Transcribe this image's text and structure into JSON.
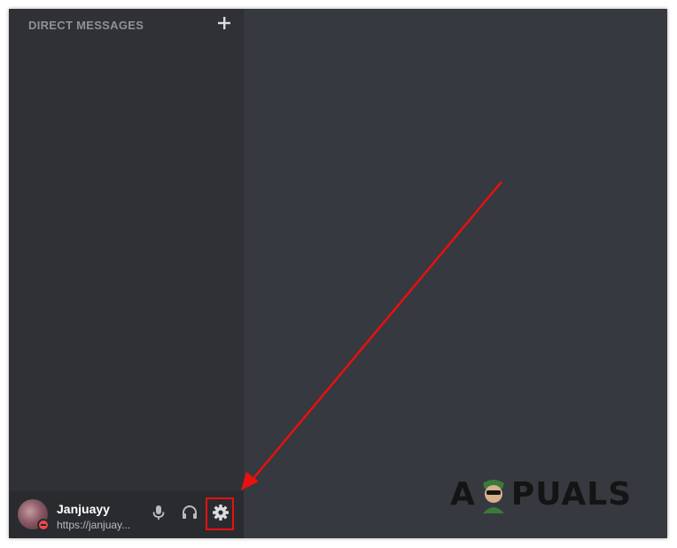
{
  "sidebar": {
    "header": "DIRECT MESSAGES",
    "add_icon": "plus-icon"
  },
  "user": {
    "name": "Janjuayy",
    "subtext": "https://janjuay...",
    "status": "do-not-disturb",
    "status_color": "#f04747"
  },
  "controls": {
    "mute_icon": "microphone-icon",
    "deafen_icon": "headphones-icon",
    "settings_icon": "gear-icon"
  },
  "annotation": {
    "arrow_color": "#e81010",
    "highlight_color": "#e81010"
  },
  "watermark": {
    "text_left": "A",
    "text_right": "PUALS"
  },
  "colors": {
    "sidebar": "#2f3136",
    "main": "#36393f",
    "userbar": "#292b2f"
  }
}
